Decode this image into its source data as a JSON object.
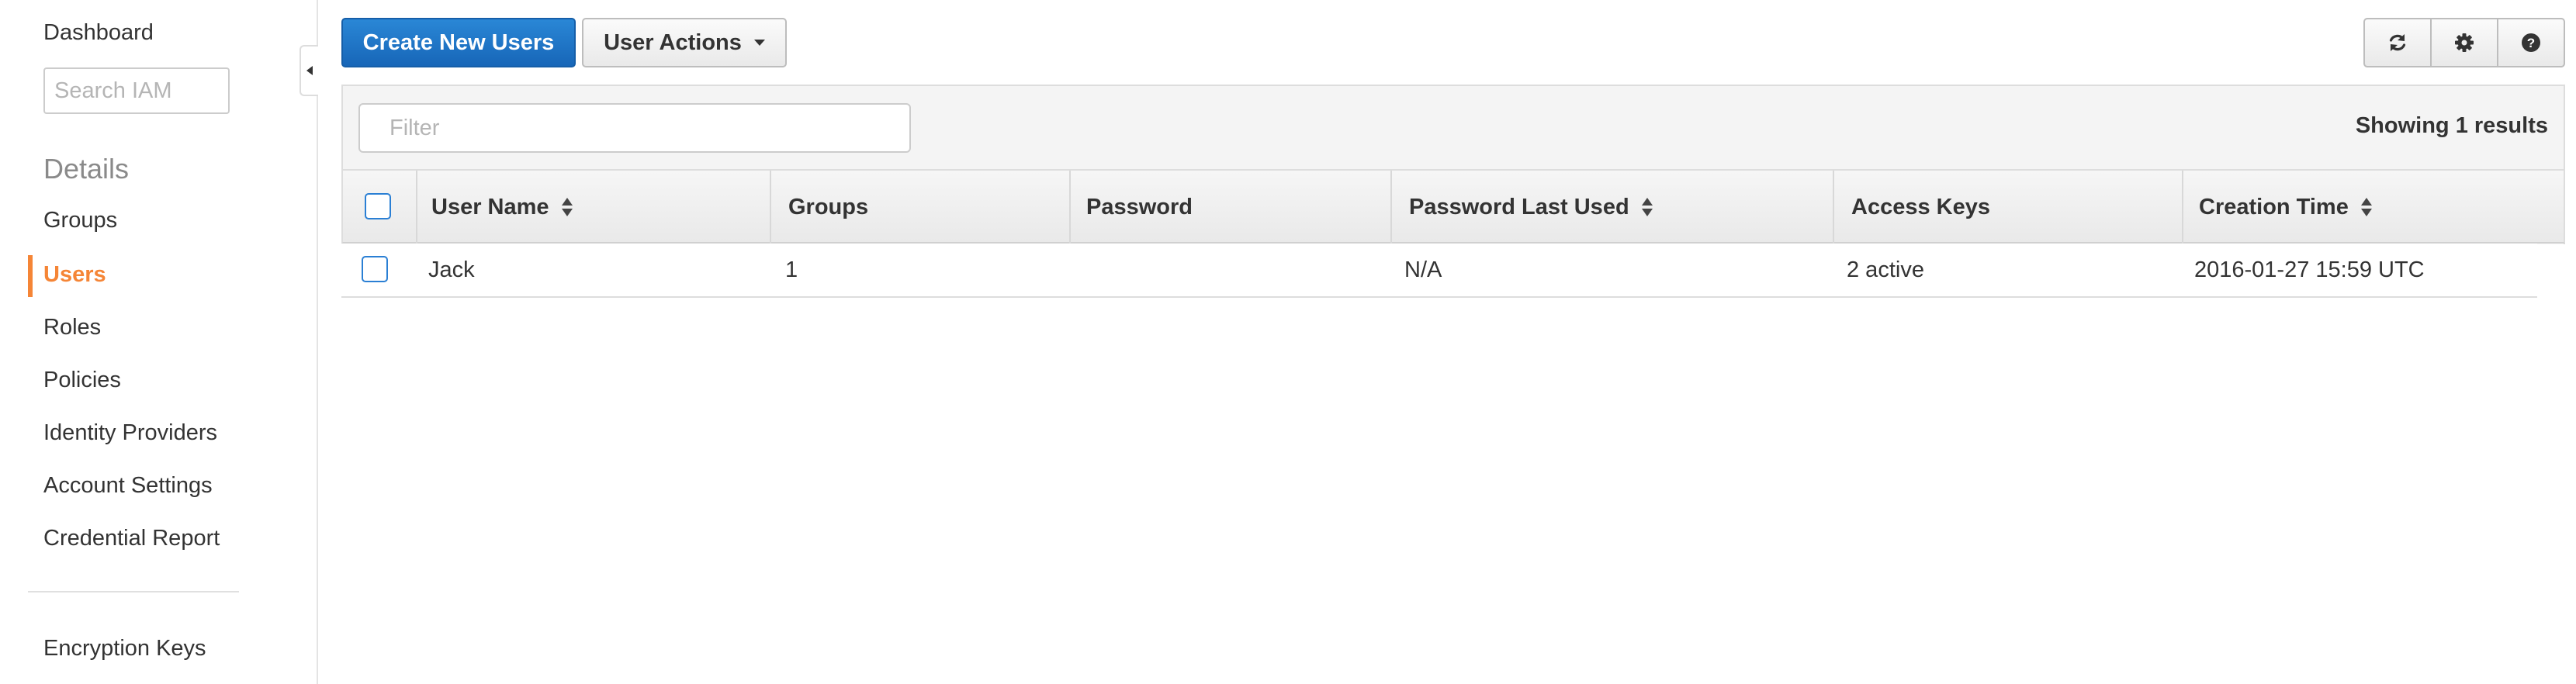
{
  "sidebar": {
    "dashboard": "Dashboard",
    "search_placeholder": "Search IAM",
    "details_heading": "Details",
    "items": [
      {
        "label": "Groups",
        "active": false
      },
      {
        "label": "Users",
        "active": true
      },
      {
        "label": "Roles",
        "active": false
      },
      {
        "label": "Policies",
        "active": false
      },
      {
        "label": "Identity Providers",
        "active": false
      },
      {
        "label": "Account Settings",
        "active": false
      },
      {
        "label": "Credential Report",
        "active": false
      }
    ],
    "encryption_keys": "Encryption Keys",
    "active_color": "#f58536"
  },
  "toolbar": {
    "create_label": "Create New Users",
    "actions_label": "User Actions",
    "icons": [
      "refresh-icon",
      "gear-icon",
      "help-icon"
    ],
    "primary_color": "#1f75c8"
  },
  "table": {
    "filter_placeholder": "Filter",
    "showing_text": "Showing 1 results",
    "columns": [
      {
        "label": "User Name",
        "sortable": true
      },
      {
        "label": "Groups",
        "sortable": false
      },
      {
        "label": "Password",
        "sortable": false
      },
      {
        "label": "Password Last Used",
        "sortable": true
      },
      {
        "label": "Access Keys",
        "sortable": false
      },
      {
        "label": "Creation Time",
        "sortable": true
      }
    ],
    "rows": [
      {
        "user_name": "Jack",
        "groups": "1",
        "password": "",
        "password_last_used": "N/A",
        "access_keys": "2 active",
        "creation_time": "2016-01-27 15:59 UTC"
      }
    ]
  }
}
